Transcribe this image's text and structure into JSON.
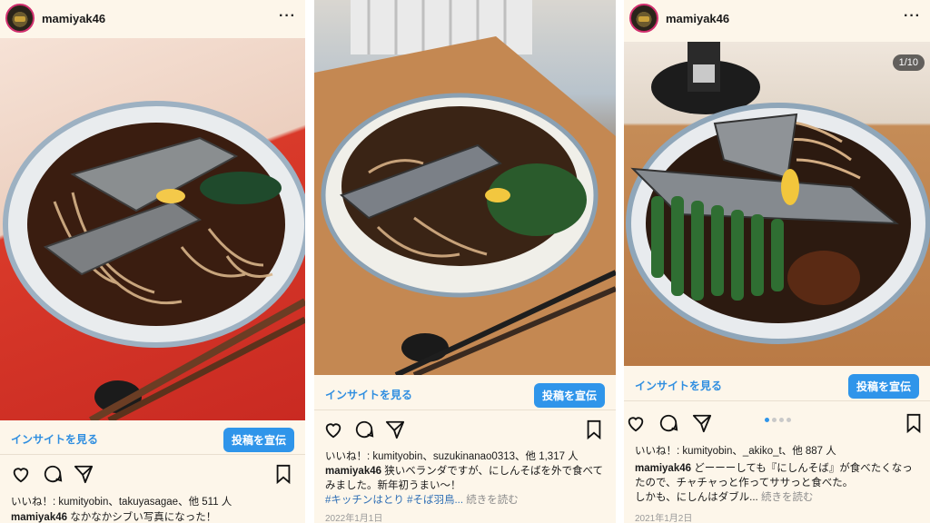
{
  "posts": [
    {
      "username": "mamiyak46",
      "insight_label": "インサイトを見る",
      "promote_label": "投稿を宣伝",
      "likes_text": "いいね！: kumityobin、takuyasagae、他 511 人",
      "caption_user": "mamiyak46",
      "caption_text": " なかなかシブい写真になった！"
    },
    {
      "username": "",
      "insight_label": "インサイトを見る",
      "promote_label": "投稿を宣伝",
      "likes_text": "いいね！: kumityobin、suzukinanao0313、他 1,317 人",
      "caption_user": "mamiyak46",
      "caption_text": " 狭いベランダですが、にしんそばを外で食べてみました。新年初うまい〜！",
      "caption_tags": "#キッチンはとり #そば羽鳥...",
      "more_label": " 続きを読む",
      "date": "2022年1月1日"
    },
    {
      "username": "mamiyak46",
      "counter": "1/10",
      "insight_label": "インサイトを見る",
      "promote_label": "投稿を宣伝",
      "likes_text": "いいね！: kumityobin、_akiko_t、他 887 人",
      "caption_user": "mamiyak46",
      "caption_text": " どーーーしても『にしんそば』が食べたくなったので、チャチャっと作ってササっと食べた。",
      "caption_more": "しかも、にしんはダブル...",
      "more_label": " 続きを読む",
      "date": "2021年1月2日"
    }
  ],
  "icons": {
    "like": "heart-icon",
    "comment": "comment-icon",
    "share": "send-icon",
    "save": "bookmark-icon",
    "more": "more-icon"
  },
  "colors": {
    "accent": "#2f95ea",
    "link": "#2f8ee0",
    "background": "#fdf6ea"
  }
}
